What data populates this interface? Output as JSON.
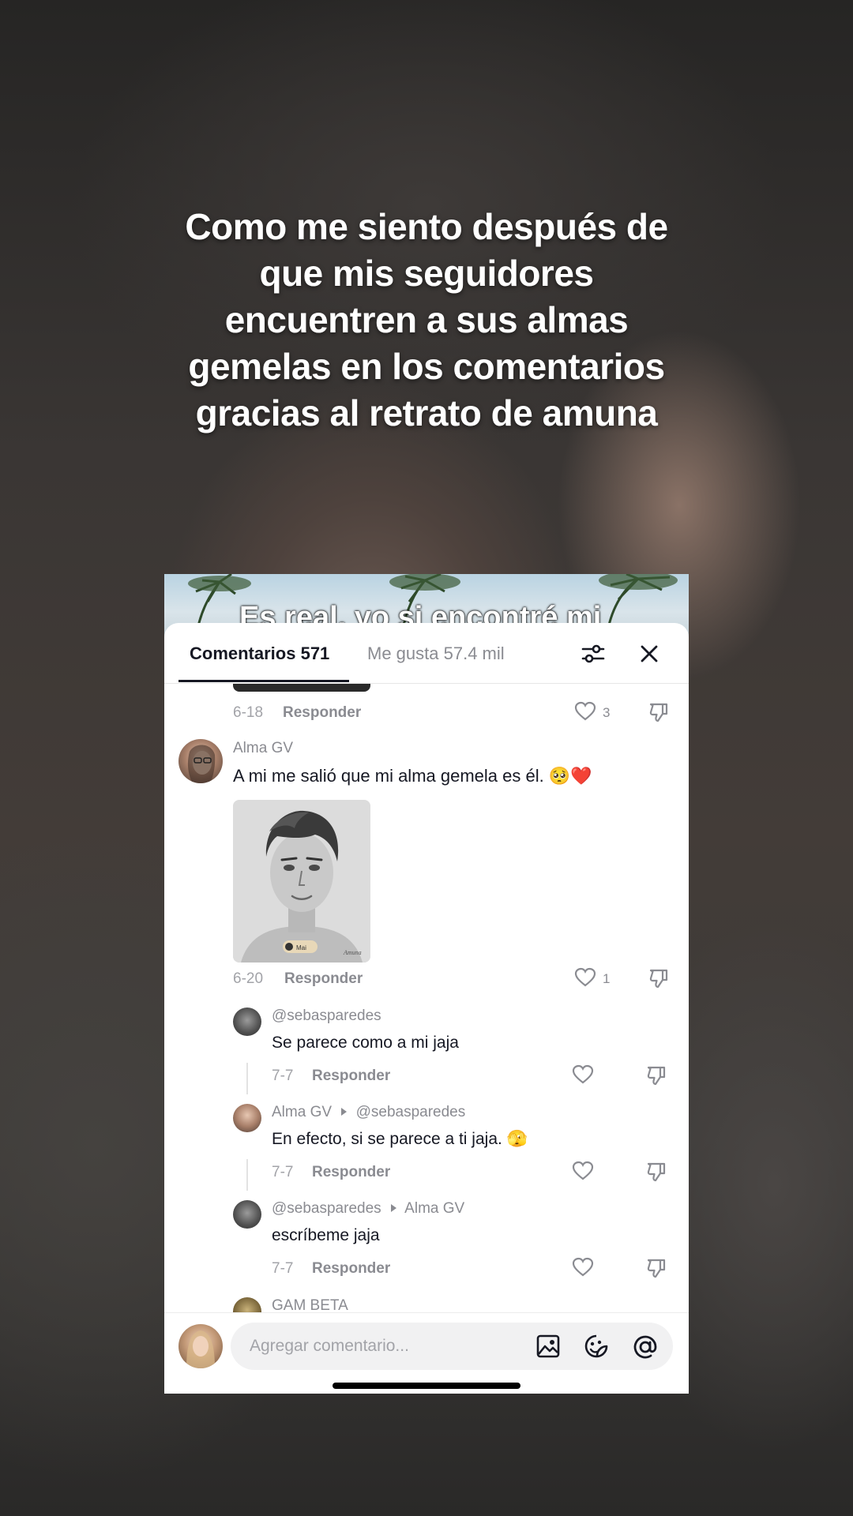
{
  "overlay_caption": {
    "lines": [
      "Como me siento después de",
      "que mis seguidores",
      "encuentren a sus almas",
      "gemelas en los comentarios",
      "gracias al retrato de amuna"
    ]
  },
  "embedded_video": {
    "caption_fragment": "Es real, yo si encontré mi"
  },
  "tabs": {
    "comments": "Comentarios 571",
    "likes": "Me gusta 57.4 mil"
  },
  "header_icons": {
    "filter": "sliders-icon",
    "close": "close-icon"
  },
  "prev_comment_meta": {
    "date": "6-18",
    "reply": "Responder",
    "likes": "3"
  },
  "comment_main": {
    "user": "Alma GV",
    "text": "A mi me salió que mi alma gemela es él.",
    "emojis": "🥺❤️",
    "image_badge": "Mai",
    "image_signature": "Amuna",
    "date": "6-20",
    "reply": "Responder",
    "likes": "1"
  },
  "replies": [
    {
      "user": "@sebasparedes",
      "reply_to": "",
      "text": "Se parece como a mi jaja",
      "date": "7-7",
      "reply": "Responder"
    },
    {
      "user": "Alma GV",
      "reply_to": "@sebasparedes",
      "text": "En efecto, si se parece a ti jaja. 🫣",
      "date": "7-7",
      "reply": "Responder"
    },
    {
      "user": "@sebasparedes",
      "reply_to": "Alma GV",
      "text": "escríbeme jaja",
      "date": "7-7",
      "reply": "Responder"
    }
  ],
  "next_comment_user": "GAM BETA",
  "input": {
    "placeholder": "Agregar comentario...",
    "icons": [
      "image-icon",
      "sticker-icon",
      "mention-icon"
    ]
  },
  "colors": {
    "text_primary": "#161823",
    "text_secondary": "#8a8b91",
    "heart_red": "#e02a3a"
  }
}
